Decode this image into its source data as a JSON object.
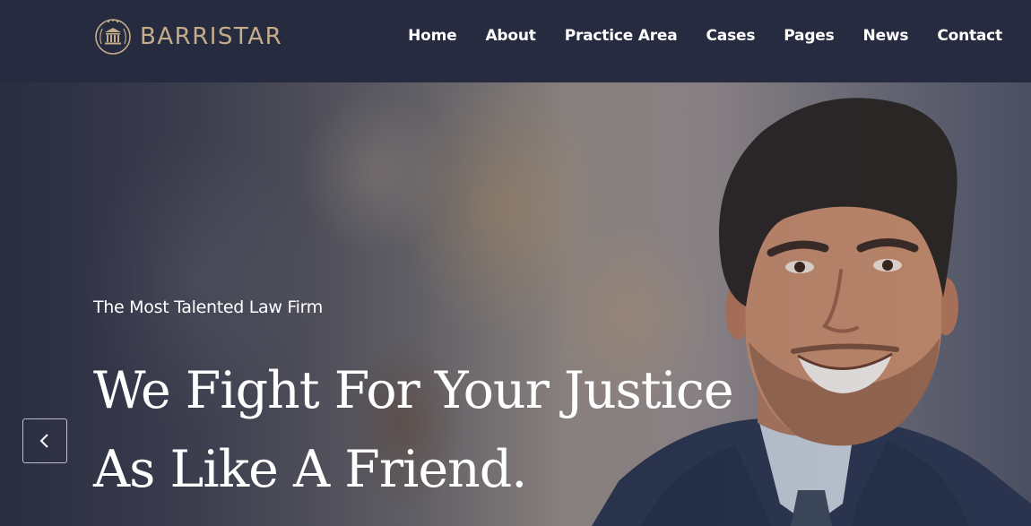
{
  "brand": {
    "name": "BARRISTAR",
    "logo_icon": "courthouse-icon",
    "color": "#c3ad8a"
  },
  "nav": {
    "items": [
      {
        "label": "Home"
      },
      {
        "label": "About"
      },
      {
        "label": "Practice Area"
      },
      {
        "label": "Cases"
      },
      {
        "label": "Pages"
      },
      {
        "label": "News"
      },
      {
        "label": "Contact"
      }
    ]
  },
  "hero": {
    "tagline": "The Most Talented Law Firm",
    "headline": "We Fight For Your Justice As Like A Friend.",
    "image": "portrait of smiling man in suit",
    "prev_icon": "chevron-left-icon"
  },
  "colors": {
    "header_bg": "#272b3f",
    "text": "#ffffff"
  }
}
